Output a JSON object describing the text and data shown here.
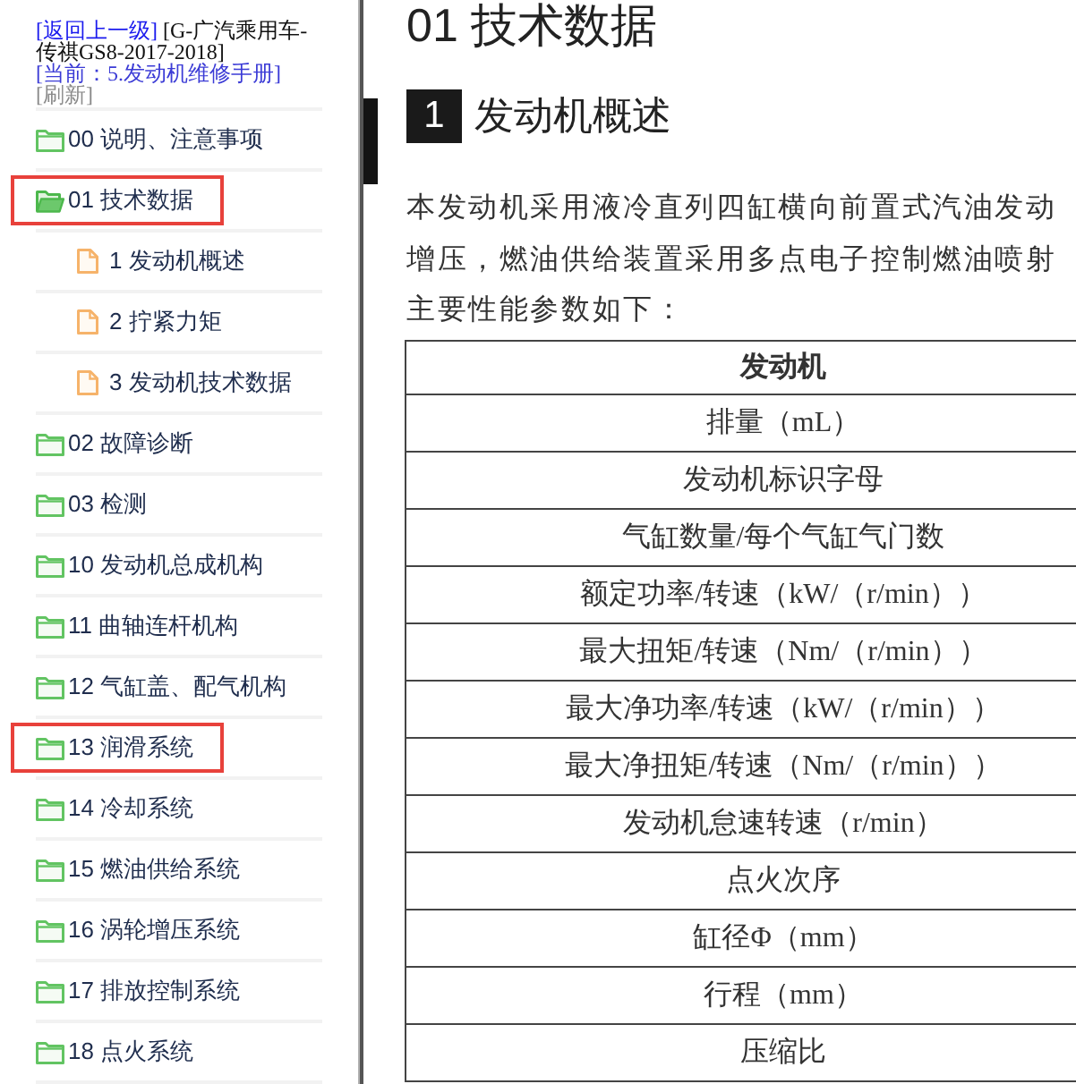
{
  "header": {
    "back_link": "[返回上一级]",
    "vehicle": "[G-广汽乘用车-传祺GS8-2017-2018]",
    "current": "[当前：5.发动机维修手册]",
    "refresh": "[刷新]"
  },
  "tree": [
    {
      "kind": "folder",
      "label": "00 说明、注意事项",
      "expanded": false,
      "highlighted": false
    },
    {
      "kind": "folder",
      "label": "01 技术数据",
      "expanded": true,
      "highlighted": true,
      "children": [
        {
          "kind": "document",
          "label": "1 发动机概述",
          "highlighted": false
        },
        {
          "kind": "document",
          "label": "2 拧紧力矩",
          "highlighted": false
        },
        {
          "kind": "document",
          "label": "3 发动机技术数据",
          "highlighted": false
        }
      ]
    },
    {
      "kind": "folder",
      "label": "02 故障诊断",
      "expanded": false,
      "highlighted": false
    },
    {
      "kind": "folder",
      "label": "03 检测",
      "expanded": false,
      "highlighted": false
    },
    {
      "kind": "folder",
      "label": "10 发动机总成机构",
      "expanded": false,
      "highlighted": false
    },
    {
      "kind": "folder",
      "label": "11 曲轴连杆机构",
      "expanded": false,
      "highlighted": false
    },
    {
      "kind": "folder",
      "label": "12 气缸盖、配气机构",
      "expanded": false,
      "highlighted": false
    },
    {
      "kind": "folder",
      "label": "13 润滑系统",
      "expanded": false,
      "highlighted": true
    },
    {
      "kind": "folder",
      "label": "14 冷却系统",
      "expanded": false,
      "highlighted": false
    },
    {
      "kind": "folder",
      "label": "15 燃油供给系统",
      "expanded": false,
      "highlighted": false
    },
    {
      "kind": "folder",
      "label": "16 涡轮增压系统",
      "expanded": false,
      "highlighted": false
    },
    {
      "kind": "folder",
      "label": "17 排放控制系统",
      "expanded": false,
      "highlighted": false
    },
    {
      "kind": "folder",
      "label": "18 点火系统",
      "expanded": false,
      "highlighted": false
    }
  ],
  "document": {
    "title": "01 技术数据",
    "section": {
      "number": "1",
      "title": "发动机概述"
    },
    "paragraph_lines": [
      "本发动机采用液冷直列四缸横向前置式汽油发动",
      "增压，燃油供给装置采用多点电子控制燃油喷射",
      "主要性能参数如下："
    ],
    "table": {
      "columns": [
        "发动机"
      ],
      "rows": [
        [
          "排量（mL）"
        ],
        [
          "发动机标识字母"
        ],
        [
          "气缸数量/每个气缸气门数"
        ],
        [
          "额定功率/转速（kW/（r/min））"
        ],
        [
          "最大扭矩/转速（Nm/（r/min））"
        ],
        [
          "最大净功率/转速（kW/（r/min））"
        ],
        [
          "最大净扭矩/转速（Nm/（r/min））"
        ],
        [
          "发动机怠速转速（r/min）"
        ],
        [
          "点火次序"
        ],
        [
          "缸径Φ（mm）"
        ],
        [
          "行程（mm）"
        ],
        [
          "压缩比"
        ]
      ]
    }
  }
}
